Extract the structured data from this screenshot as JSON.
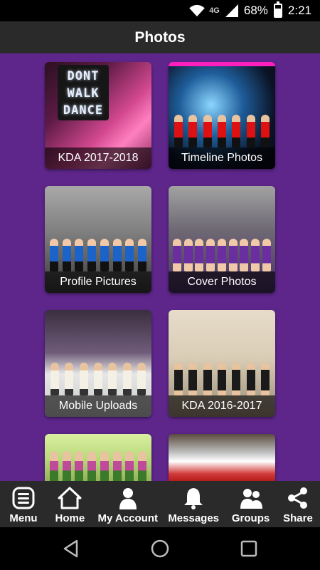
{
  "status_bar": {
    "network": "4G",
    "battery": "68%",
    "time": "2:21"
  },
  "header": {
    "title": "Photos"
  },
  "albums": [
    {
      "label": "KDA 2017-2018",
      "sign_lines": [
        "DONT",
        "WALK",
        "DANCE"
      ]
    },
    {
      "label": "Timeline Photos"
    },
    {
      "label": "Profile Pictures"
    },
    {
      "label": "Cover Photos"
    },
    {
      "label": "Mobile Uploads"
    },
    {
      "label": "KDA 2016-2017"
    },
    {
      "label": ""
    },
    {
      "label": ""
    }
  ],
  "tab_bar": {
    "items": [
      {
        "label": "Menu",
        "icon": "menu-icon"
      },
      {
        "label": "Home",
        "icon": "home-icon"
      },
      {
        "label": "My Account",
        "icon": "person-icon"
      },
      {
        "label": "Messages",
        "icon": "bell-icon"
      },
      {
        "label": "Groups",
        "icon": "group-icon"
      },
      {
        "label": "Share",
        "icon": "share-icon"
      }
    ]
  },
  "colors": {
    "content_bg": "#5e268b",
    "bar_bg": "#2a2a2a",
    "text": "#ffffff"
  }
}
